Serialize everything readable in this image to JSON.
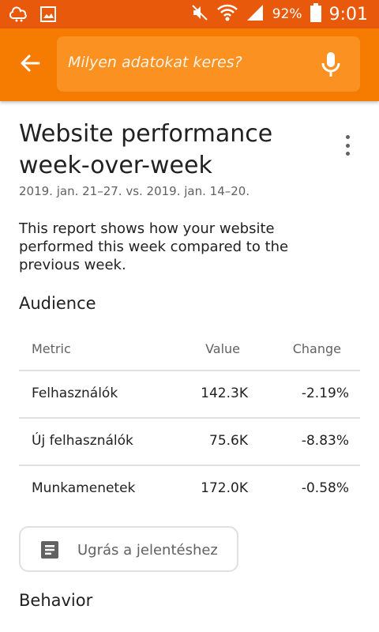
{
  "status_bar": {
    "battery": "92%",
    "time": "9:01",
    "background": "#e8590c",
    "icons": [
      "notification-icon",
      "image-icon",
      "mute-icon",
      "wifi-icon",
      "signal-icon",
      "battery-icon"
    ]
  },
  "app_bar": {
    "background": "#f57c00",
    "search_placeholder": "Milyen adatokat keres?",
    "back_icon": "arrow-back-icon",
    "mic_icon": "mic-icon"
  },
  "report": {
    "title": "Website performance week-over-week",
    "date_range": "2019. jan. 21–27. vs. 2019. jan. 14–20.",
    "description": "This report shows how your website performed this week compared to the previous week."
  },
  "audience": {
    "heading": "Audience",
    "columns": [
      "Metric",
      "Value",
      "Change"
    ],
    "rows": [
      {
        "metric": "Felhasználók",
        "value": "142.3K",
        "change": "-2.19%"
      },
      {
        "metric": "Új felhasználók",
        "value": "75.6K",
        "change": "-8.83%"
      },
      {
        "metric": "Munkamenetek",
        "value": "172.0K",
        "change": "-0.58%"
      }
    ],
    "report_button": "Ugrás a jelentéshez"
  },
  "behavior": {
    "heading": "Behavior"
  }
}
